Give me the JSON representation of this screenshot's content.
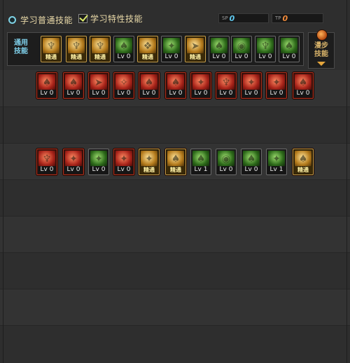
{
  "header": {
    "normal_skill_label": "学习普通技能",
    "special_skill_label": "学习特性技能",
    "sp_tag": "SP",
    "sp_value": "0",
    "tp_tag": "TP",
    "tp_value": "0"
  },
  "general_panel": {
    "label": "通用\n技能",
    "skills": [
      {
        "caption": "精通",
        "icon": "dash-icon"
      },
      {
        "caption": "精通",
        "icon": "leap-icon"
      },
      {
        "caption": "精通",
        "icon": "kick-icon"
      },
      {
        "caption": "Lv 0",
        "icon": "wings-icon"
      },
      {
        "caption": "精通",
        "icon": "crosshair-icon"
      },
      {
        "caption": "Lv 0",
        "icon": "target-icon"
      },
      {
        "caption": "精通",
        "icon": "mushroom-icon"
      },
      {
        "caption": "Lv 0",
        "icon": "burst-icon"
      },
      {
        "caption": "Lv 0",
        "icon": "eye-icon"
      },
      {
        "caption": "Lv 0",
        "icon": "aura-icon"
      },
      {
        "caption": "Lv 0",
        "icon": "shard-icon"
      }
    ]
  },
  "switch_panel": {
    "label": "漫步\n技能"
  },
  "row1": [
    {
      "caption": "Lv 0",
      "icon": "slash-icon"
    },
    {
      "caption": "Lv 0",
      "icon": "armor-icon"
    },
    {
      "caption": "Lv 0",
      "icon": "fireball-icon"
    },
    {
      "caption": "Lv 0",
      "icon": "warrior-icon"
    },
    {
      "caption": "Lv 0",
      "icon": "flame-icon"
    },
    {
      "caption": "Lv 0",
      "icon": "smash-icon"
    },
    {
      "caption": "Lv 0",
      "icon": "vortex-icon"
    },
    {
      "caption": "Lv 0",
      "icon": "claw-icon"
    },
    {
      "caption": "Lv 0",
      "icon": "figure-icon"
    },
    {
      "caption": "Lv 0",
      "icon": "strike-icon"
    },
    {
      "caption": "Lv 0",
      "icon": "blast-icon"
    }
  ],
  "row2": [
    {
      "caption": "Lv 0",
      "icon": "rage-icon",
      "style": "red"
    },
    {
      "caption": "Lv 0",
      "icon": "hammer-icon",
      "style": "red"
    },
    {
      "caption": "Lv 0",
      "icon": "sprint-icon",
      "style": "green"
    },
    {
      "caption": "Lv 0",
      "icon": "spiral-icon",
      "style": "red"
    },
    {
      "caption": "精通",
      "icon": "pierce-icon",
      "style": "master"
    },
    {
      "caption": "精通",
      "icon": "whirl-icon",
      "style": "master"
    },
    {
      "caption": "Lv 1",
      "icon": "guard-icon",
      "style": "green"
    },
    {
      "caption": "Lv 0",
      "icon": "orb-icon",
      "style": "green"
    },
    {
      "caption": "Lv 0",
      "icon": "lunge-icon",
      "style": "green"
    },
    {
      "caption": "Lv 1",
      "icon": "dagger-icon",
      "style": "green"
    },
    {
      "caption": "精通",
      "icon": "grass-icon",
      "style": "master"
    }
  ],
  "colors": {
    "accent_cyan": "#5ec8ee",
    "accent_orange": "#f08a3a",
    "master_gold": "#fff2a6",
    "background": "#2b2b2b"
  }
}
